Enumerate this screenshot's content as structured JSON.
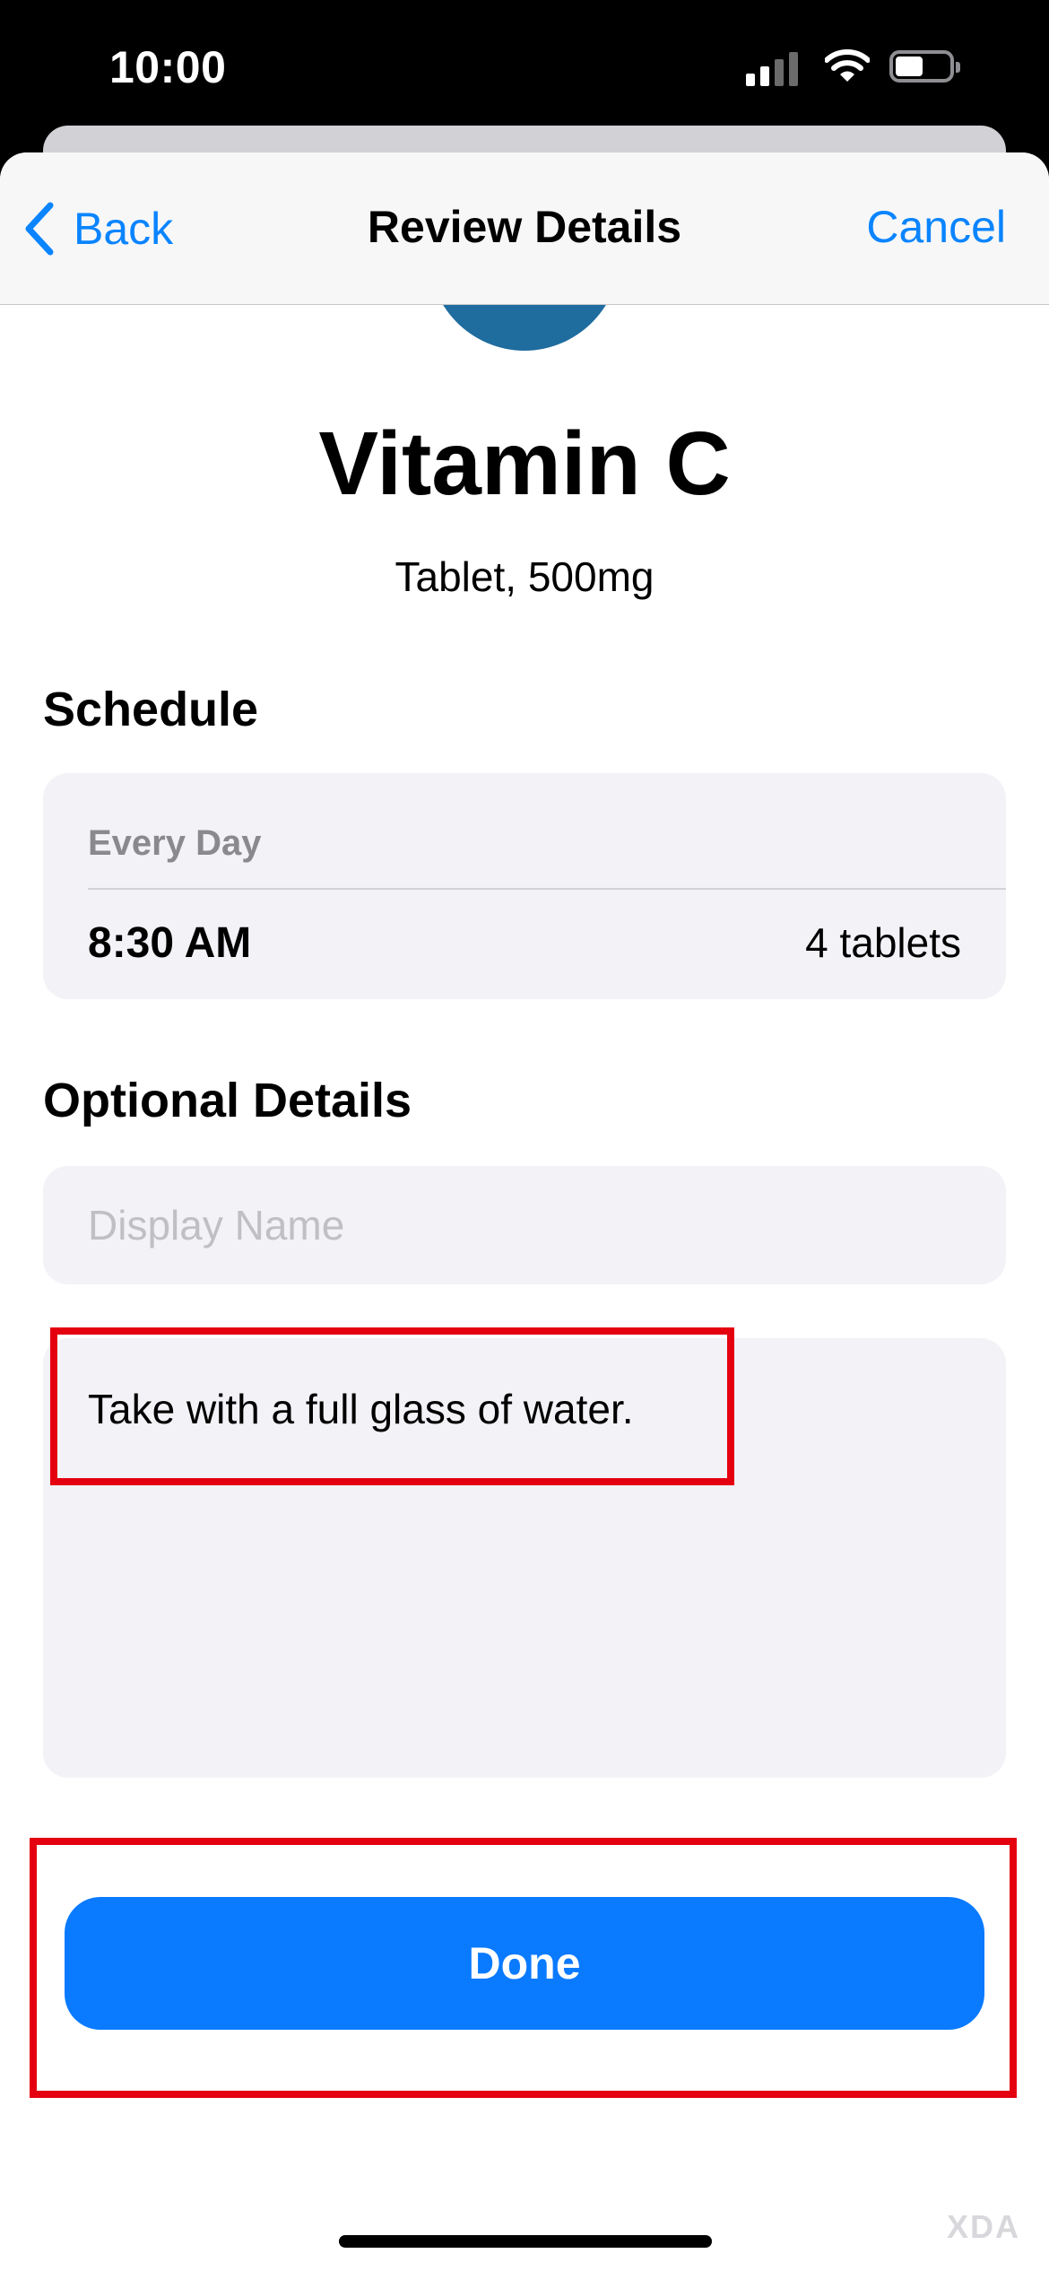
{
  "status_bar": {
    "time": "10:00",
    "icons": [
      "cellular-signal-icon",
      "wifi-icon",
      "battery-icon"
    ]
  },
  "nav": {
    "back_label": "Back",
    "title": "Review Details",
    "cancel_label": "Cancel",
    "accent_color": "#0A84FF"
  },
  "medication": {
    "icon": "pill-icon",
    "name": "Vitamin C",
    "detail": "Tablet, 500mg"
  },
  "schedule": {
    "section_title": "Schedule",
    "frequency": "Every Day",
    "time": "8:30 AM",
    "dose": "4 tablets"
  },
  "optional_details": {
    "section_title": "Optional Details",
    "display_name_value": "",
    "display_name_placeholder": "Display Name",
    "notes": "Take with a full glass of water."
  },
  "done_label": "Done",
  "highlight_color": "#E4000F",
  "watermark": "XDA"
}
